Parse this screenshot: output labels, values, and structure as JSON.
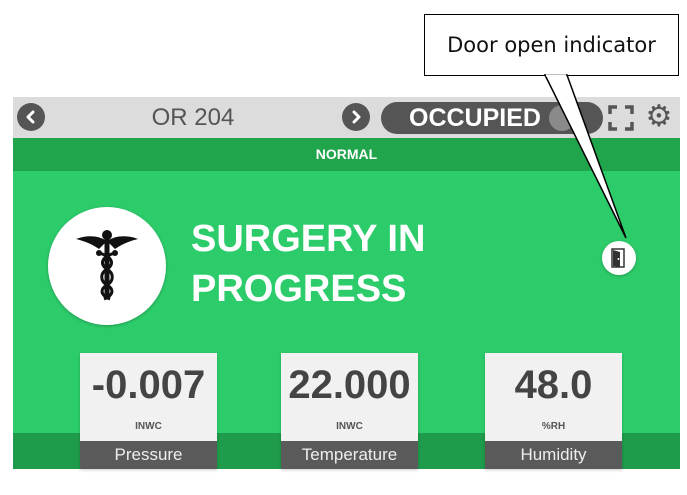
{
  "callout": {
    "text": "Door open indicator"
  },
  "header": {
    "prev_icon": "chevron-left-icon",
    "room": "OR 204",
    "next_icon": "chevron-right-icon",
    "occupancy": "OCCUPIED",
    "expand_icon": "fullscreen-icon",
    "settings_icon": "gear-icon"
  },
  "status_strip": {
    "text": "NORMAL"
  },
  "main": {
    "icon": "caduceus-icon",
    "status_line1": "SURGERY IN",
    "status_line2": "PROGRESS",
    "door_icon": "door-open-icon"
  },
  "metrics": [
    {
      "value": "-0.007",
      "unit": "INWC",
      "label": "Pressure"
    },
    {
      "value": "22.000",
      "unit": "INWC",
      "label": "Temperature"
    },
    {
      "value": "48.0",
      "unit": "%RH",
      "label": "Humidity"
    }
  ],
  "colors": {
    "green_main": "#2dcc6b",
    "green_strip": "#21a54c",
    "green_band": "#1f9c4b",
    "bar_gray": "#dcdcdc",
    "dark_gray": "#555555"
  }
}
